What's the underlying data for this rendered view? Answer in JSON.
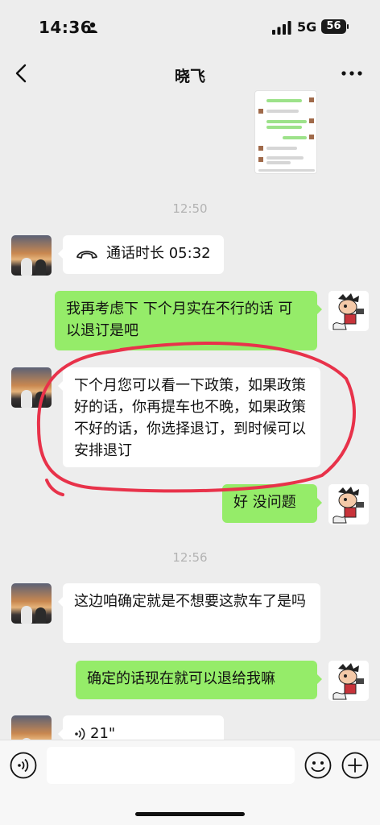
{
  "status_bar": {
    "time": "14:36",
    "network": "5G",
    "battery": "56"
  },
  "header": {
    "title": "晓飞",
    "back_icon": "chevron-left-icon",
    "more_icon": "ellipsis-icon"
  },
  "messages": [
    {
      "type": "image",
      "sender": "me",
      "content": "chat-screenshot-thumbnail"
    },
    {
      "type": "timestamp",
      "text": "12:50"
    },
    {
      "type": "call",
      "sender": "friend",
      "text": "通话时长 05:32"
    },
    {
      "type": "text",
      "sender": "me",
      "text": "我再考虑下 下个月实在不行的话 可以退订是吧"
    },
    {
      "type": "text",
      "sender": "friend",
      "text": "下个月您可以看一下政策，如果政策好的话，你再提车也不晚，如果政策不好的话，你选择退订，到时候可以安排退订",
      "highlighted": true
    },
    {
      "type": "text",
      "sender": "me",
      "text": "好 没问题"
    },
    {
      "type": "timestamp",
      "text": "12:56"
    },
    {
      "type": "text",
      "sender": "friend",
      "text": "这边咱确定就是不想要这款车了是吗"
    },
    {
      "type": "text",
      "sender": "me",
      "text": "确定的话现在就可以退给我嘛"
    },
    {
      "type": "voice",
      "sender": "friend",
      "text": "21\""
    }
  ],
  "annotation": {
    "color": "#e8324a"
  },
  "input_bar": {
    "voice_icon": "voice-mode-icon",
    "emoji_icon": "emoji-icon",
    "plus_icon": "plus-icon"
  },
  "colors": {
    "background": "#ededed",
    "my_bubble": "#95ec69",
    "friend_bubble": "#ffffff"
  }
}
